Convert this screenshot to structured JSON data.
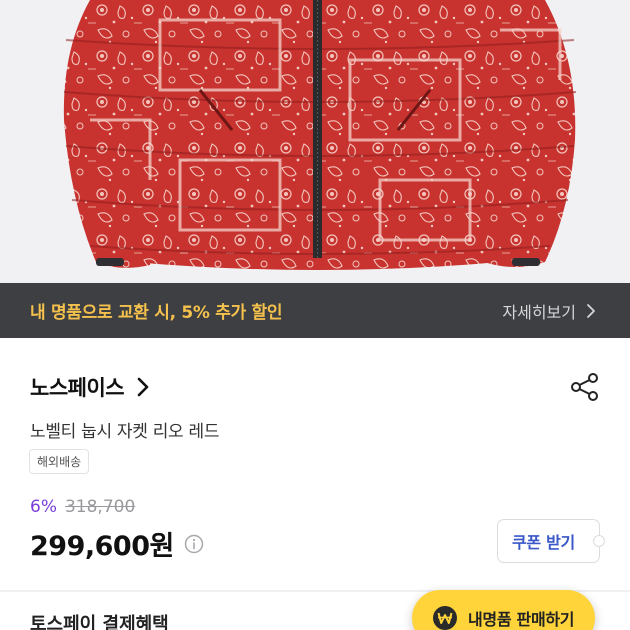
{
  "promo": {
    "text": "내 명품으로 교환 시, 5% 추가 할인",
    "link_label": "자세히보기"
  },
  "product": {
    "brand": "노스페이스",
    "name": "노벨티 눕시 자켓 리오 레드",
    "shipping_badge": "해외배송",
    "discount": "6%",
    "original_price": "318,700",
    "price": "299,600원",
    "coupon_label": "쿠폰 받기"
  },
  "payment_section": {
    "title": "토스페이 결제혜택"
  },
  "sell_button": {
    "label": "내명품 판매하기"
  },
  "colors": {
    "promo_bg": "#3e3f42",
    "promo_text": "#f4c14d",
    "discount": "#7b3fd9",
    "coupon_text": "#3a57c9",
    "sell_button_bg": "#ffd43b",
    "jacket_red": "#c8322f"
  },
  "icons": {
    "share": "share-icon",
    "info": "info-icon",
    "chevron": "chevron-right-icon",
    "sell": "won-coin-icon"
  }
}
